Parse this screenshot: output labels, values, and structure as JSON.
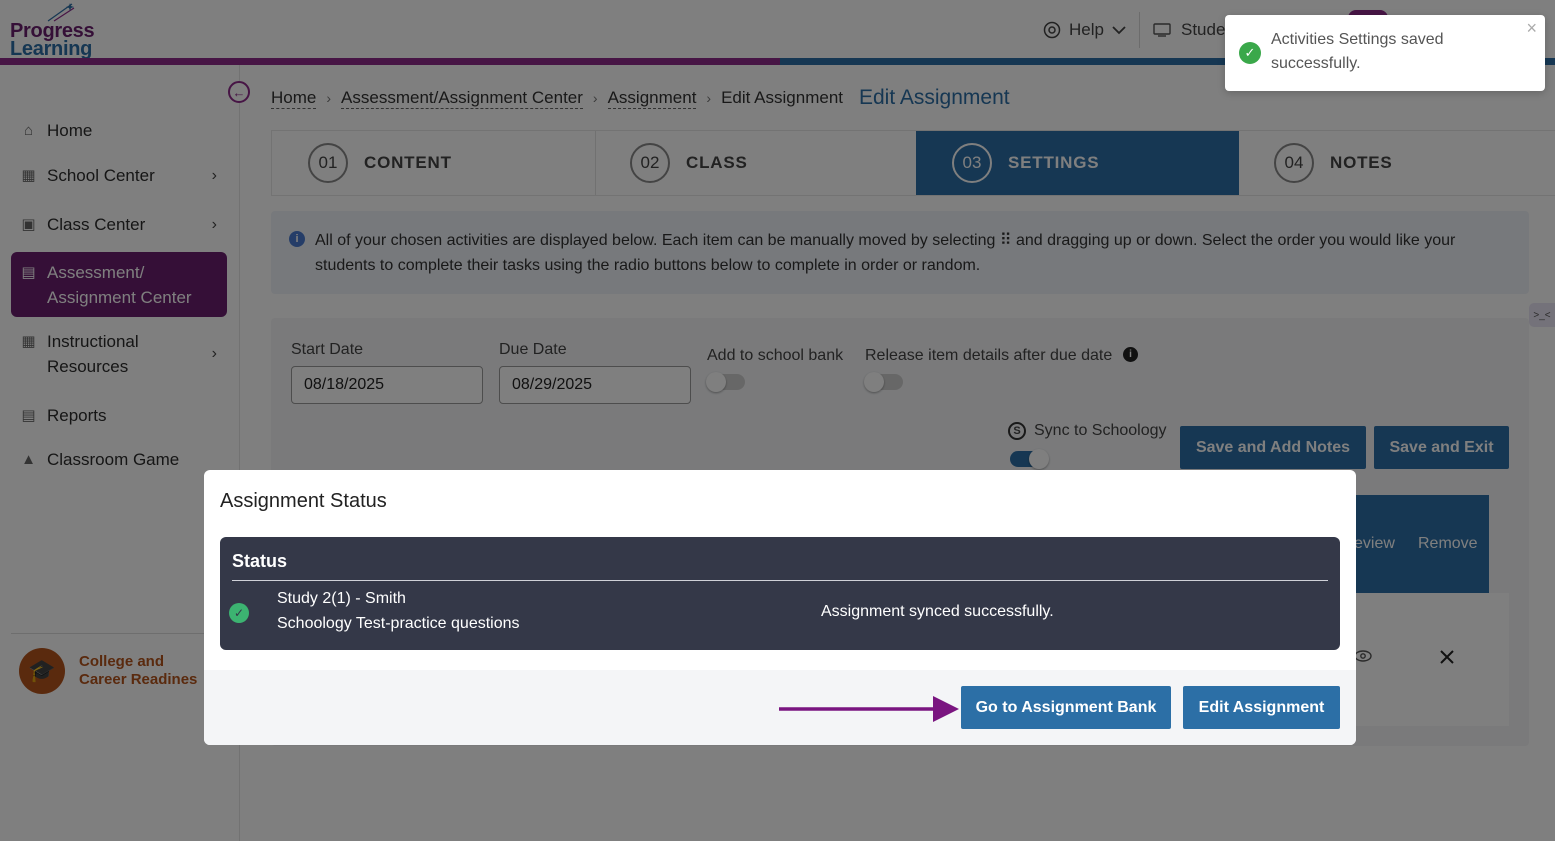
{
  "header": {
    "logo_line1": "Progress",
    "logo_line2": "Learning",
    "help_label": "Help",
    "student_label": "Stude"
  },
  "sidebar": {
    "items": [
      {
        "label": "Home",
        "icon": "home-icon"
      },
      {
        "label": "School Center",
        "icon": "school-icon"
      },
      {
        "label": "Class Center",
        "icon": "class-icon"
      },
      {
        "label": "Assessment/ Assignment Center",
        "icon": "book-icon"
      },
      {
        "label": "Instructional Resources",
        "icon": "book-open-icon"
      },
      {
        "label": "Reports",
        "icon": "report-icon"
      },
      {
        "label": "Classroom Game",
        "icon": "game-icon"
      }
    ],
    "ccr_line1": "College and",
    "ccr_line2": "Career Readines"
  },
  "breadcrumb": {
    "items": [
      "Home",
      "Assessment/Assignment Center",
      "Assignment",
      "Edit Assignment"
    ],
    "current": "Edit Assignment"
  },
  "steps": [
    {
      "num": "01",
      "label": "CONTENT"
    },
    {
      "num": "02",
      "label": "CLASS"
    },
    {
      "num": "03",
      "label": "SETTINGS"
    },
    {
      "num": "04",
      "label": "NOTES"
    }
  ],
  "info_text": "All of your chosen activities are displayed below. Each item can be manually moved by selecting ⠿ and dragging up or down. Select the order you would like your students to complete their tasks using the radio buttons below to complete in order or random.",
  "form": {
    "start_label": "Start Date",
    "start_value": "08/18/2025",
    "due_label": "Due Date",
    "due_value": "08/29/2025",
    "school_bank_label": "Add to school bank",
    "release_label": "Release item details after due date",
    "sync_label": "Sync to Schoology",
    "save_notes_label": "Save and Add Notes",
    "save_exit_label": "Save and Exit",
    "col_preview": "eview",
    "col_remove": "Remove"
  },
  "toast": {
    "message": "Activities Settings saved successfully.",
    "close": "×"
  },
  "modal": {
    "title": "Assignment Status",
    "status_header": "Status",
    "row_line1": "Study 2(1) - Smith",
    "row_line2": "Schoology Test-practice questions",
    "row_result": "Assignment synced successfully.",
    "go_bank_label": "Go to Assignment Bank",
    "edit_label": "Edit Assignment"
  },
  "colors": {
    "brand_purple": "#6b1f6e",
    "brand_blue": "#2c6fa6",
    "arrow": "#7a1580",
    "success": "#3aa84a"
  }
}
